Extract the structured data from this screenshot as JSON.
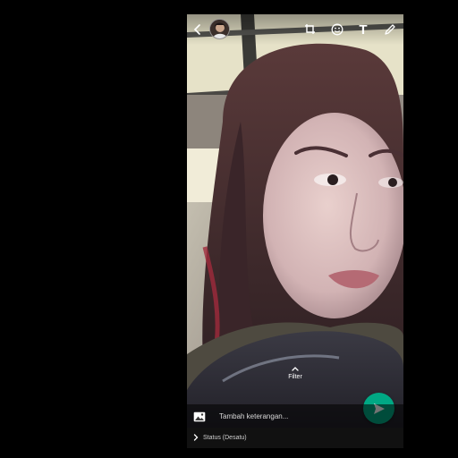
{
  "toolbar": {
    "back_icon": "arrow-left-icon",
    "avatar_icon": "profile-avatar",
    "crop_icon": "crop-rotate-icon",
    "emoji_icon": "emoji-smiley-icon",
    "text_icon": "text-T-icon",
    "draw_icon": "pencil-icon",
    "text_glyph": "T"
  },
  "filter": {
    "label": "Filter",
    "icon": "chevron-up-icon"
  },
  "caption": {
    "placeholder": "Tambah keterangan...",
    "gallery_icon": "image-gallery-icon"
  },
  "send": {
    "icon": "send-arrow-icon",
    "color": "#00a884"
  },
  "status": {
    "label": "Status (Desatu)",
    "icon": "chevron-right-icon"
  }
}
